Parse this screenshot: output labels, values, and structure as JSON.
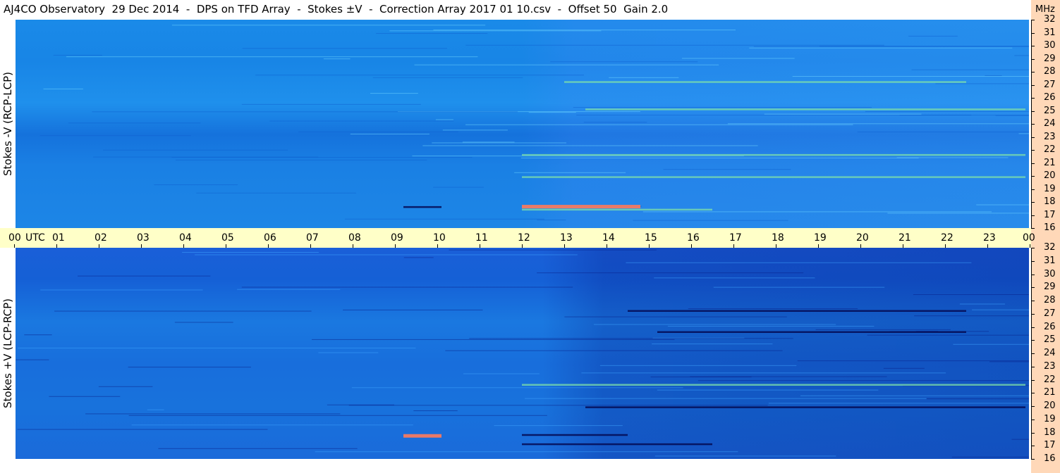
{
  "title": "AJ4CO Observatory  29 Dec 2014  -  DPS on TFD Array  -  Stokes ±V  -  Correction Array 2017 01 10.csv  -  Offset 50  Gain 2.0",
  "chart_data": {
    "type": "heatmap",
    "title": "AJ4CO Observatory  29 Dec 2014  -  DPS on TFD Array  -  Stokes ±V  -  Correction Array 2017 01 10.csv  -  Offset 50  Gain 2.0",
    "x_tick_labels": [
      "00",
      "01",
      "02",
      "03",
      "04",
      "05",
      "06",
      "07",
      "08",
      "09",
      "10",
      "11",
      "12",
      "13",
      "14",
      "15",
      "16",
      "17",
      "18",
      "19",
      "20",
      "21",
      "22",
      "23",
      "00"
    ],
    "x_unit_label": "UTC",
    "xlim": [
      0,
      24
    ],
    "y_unit_label": "MHz",
    "ylim": [
      16,
      32
    ],
    "y_ticks": [
      32,
      31,
      30,
      29,
      28,
      27,
      26,
      25,
      24,
      23,
      22,
      21,
      20,
      19,
      18,
      17,
      16
    ],
    "panels": [
      {
        "ylabel": "Stokes -V  (RCP-LCP)",
        "features": [
          {
            "t_start": 9.2,
            "t_end": 10.1,
            "f": 17.6,
            "tone": "dark"
          },
          {
            "t_start": 12.0,
            "t_end": 14.8,
            "f": 17.7,
            "tone": "hot"
          },
          {
            "t_start": 12.0,
            "t_end": 16.5,
            "f": 17.4,
            "tone": "bright"
          },
          {
            "t_start": 12.0,
            "t_end": 23.9,
            "f": 19.9,
            "tone": "bright"
          },
          {
            "t_start": 12.0,
            "t_end": 23.9,
            "f": 21.6,
            "tone": "bright"
          },
          {
            "t_start": 13.5,
            "t_end": 23.9,
            "f": 25.1,
            "tone": "bright"
          },
          {
            "t_start": 13.0,
            "t_end": 22.5,
            "f": 27.2,
            "tone": "bright"
          }
        ]
      },
      {
        "ylabel": "Stokes +V  (LCP-RCP)",
        "features": [
          {
            "t_start": 9.2,
            "t_end": 10.1,
            "f": 17.8,
            "tone": "hot"
          },
          {
            "t_start": 12.0,
            "t_end": 14.5,
            "f": 17.8,
            "tone": "dark"
          },
          {
            "t_start": 12.0,
            "t_end": 16.5,
            "f": 17.1,
            "tone": "dark"
          },
          {
            "t_start": 13.5,
            "t_end": 23.9,
            "f": 19.9,
            "tone": "dark"
          },
          {
            "t_start": 12.0,
            "t_end": 23.9,
            "f": 21.6,
            "tone": "bright"
          },
          {
            "t_start": 15.2,
            "t_end": 22.5,
            "f": 25.6,
            "tone": "dark"
          },
          {
            "t_start": 14.5,
            "t_end": 22.5,
            "f": 27.2,
            "tone": "dark"
          }
        ]
      }
    ],
    "colors": {
      "bright": "#7fe0a8",
      "hot": "#ff7a5a",
      "dark": "#05105a",
      "x_axis_band": "#ffffc8",
      "y_axis_band": "#ffd8b8"
    }
  }
}
